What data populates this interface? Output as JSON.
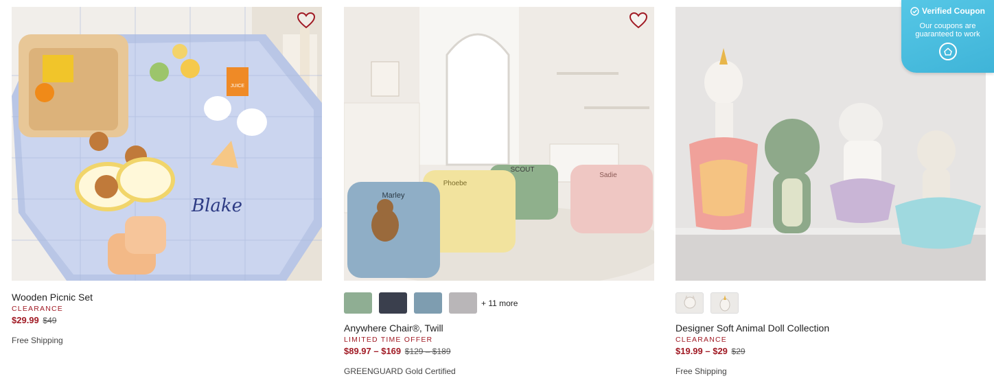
{
  "products": [
    {
      "name": "Wooden Picnic Set",
      "badge": "CLEARANCE",
      "sale_price": "$29.99",
      "orig_price": "$49",
      "meta": "Free Shipping",
      "personalization": "Blake",
      "juice_label": "JUICE"
    },
    {
      "name": "Anywhere Chair®, Twill",
      "badge": "LIMITED TIME OFFER",
      "sale_price": "$89.97 – $169",
      "orig_price": "$129 – $189",
      "meta": "GREENGUARD Gold Certified",
      "more_colors": "+ 11 more",
      "swatch_colors": [
        "#8fae93",
        "#3a3f4d",
        "#7e9db0",
        "#b9b6b8"
      ],
      "chair_names": [
        "Marley",
        "Phoebe",
        "SCOUT",
        "Sadie"
      ]
    },
    {
      "name": "Designer Soft Animal Doll Collection",
      "badge": "CLEARANCE",
      "sale_price": "$19.99 – $29",
      "orig_price": "$29",
      "meta": "Free Shipping"
    }
  ],
  "coupon": {
    "title": "Verified Coupon",
    "desc": "Our coupons are guaranteed to work"
  },
  "icons": {
    "favorite": "heart-icon",
    "verified": "check-circle-icon",
    "coupon_logo": "coupon-logo-icon"
  },
  "colors": {
    "sale": "#a01a24",
    "heart": "#a01a24",
    "coupon_bg": "#4bbfe0"
  }
}
